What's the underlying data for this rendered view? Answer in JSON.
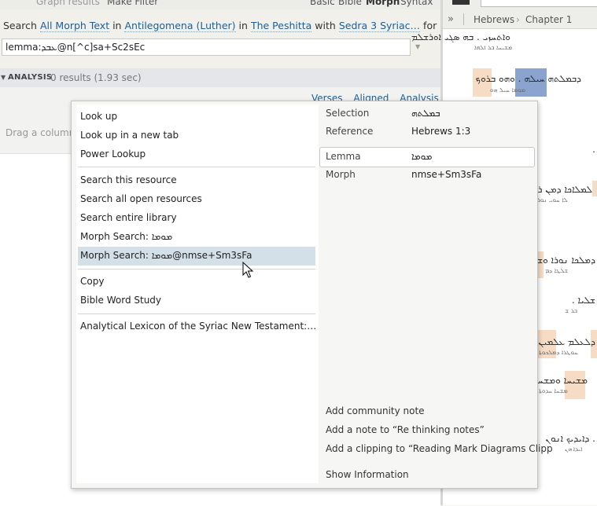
{
  "top_strip": {
    "graph_results": "Graph results",
    "make_filter": "Make Filter",
    "basic": "Basic",
    "bible": "Bible",
    "morph": "Morph",
    "syntax": "Syntax"
  },
  "search": {
    "prefix": "Search",
    "target": "All Morph Text",
    "in1": "in",
    "collection": "Antilegomena (Luther)",
    "in2": "in",
    "resource": "The Peshitta",
    "with": "with",
    "morph_db": "Sedra 3 Syriac…",
    "for": "for",
    "query": "lemma:ܥܒܕ@n[^c]sa+Sc2sEc"
  },
  "analysis": {
    "title": "ANALYSIS",
    "results": "0 results (1.93 sec)",
    "tabs": [
      "Verses",
      "Aligned",
      "Analysis"
    ],
    "drag_hint": "Drag a column"
  },
  "reader": {
    "breadcrumb_book": "Hebrews",
    "breadcrumb_chapter": "Chapter 1"
  },
  "menu": {
    "left_groups": [
      [
        "Look up",
        "Look up in a new tab",
        "Power Lookup"
      ],
      [
        "Search this resource",
        "Search all open resources",
        "Search entire library",
        "Morph Search: ܡܘܡܐ",
        "Morph Search: ܡܘܡܐ@nmse+Sm3sFa"
      ],
      [
        "Copy",
        "Bible Word Study"
      ],
      [
        "Analytical Lexicon of the Syriac New Testament:…"
      ]
    ],
    "info": {
      "selection_label": "Selection",
      "selection_value": "ܒܡܠܬܗ",
      "reference_label": "Reference",
      "reference_value": "Hebrews 1:3",
      "lemma_label": "Lemma",
      "lemma_value": "ܡܘܡܐ",
      "morph_label": "Morph",
      "morph_value": "nmse+Sm3sFa"
    },
    "actions": [
      "Add community note",
      "Add a note to “Re thinking notes”",
      "Add a clipping to “Reading Mark Diagrams Clipp"
    ],
    "show_information": "Show Information"
  },
  "colors": {
    "link": "#1d5f96",
    "word_highlight": "#f6dcc4",
    "selected_word": "#8aa4cf",
    "menu_hover": "#d3e0e8"
  },
  "icons": [
    "dropdown-arrow-icon",
    "collapse-triangle-icon",
    "chevron-right-icon",
    "mouse-cursor-icon"
  ]
}
